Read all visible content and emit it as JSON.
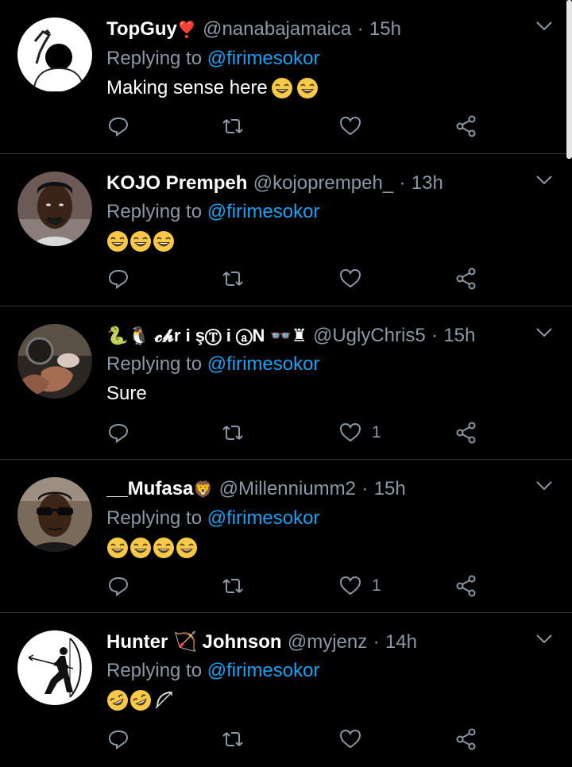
{
  "colors": {
    "background": "#000000",
    "name": "#ffffff",
    "secondary": "#8b98a5",
    "link": "#1da1f2",
    "divider": "#2f3336",
    "heart_icon": "#e0245e"
  },
  "reply_prefix": "Replying to",
  "tweets": [
    {
      "name": "TopGuy",
      "name_emoji": "❣️",
      "handle": "@nanabajamaica",
      "dot": "·",
      "time": "15h",
      "reply_to": "@firimesokor",
      "text": "Making sense here",
      "emojis": [
        "laughing-emoji",
        "laughing-emoji"
      ],
      "likes": "",
      "icons": [
        "reply-icon",
        "retweet-icon",
        "like-icon",
        "share-icon"
      ]
    },
    {
      "name": "KOJO Prempeh",
      "handle": "@kojoprempeh_",
      "dot": "·",
      "time": "13h",
      "reply_to": "@firimesokor",
      "text": "",
      "emojis": [
        "laughing-emoji",
        "laughing-emoji",
        "laughing-emoji"
      ],
      "likes": "",
      "icons": [
        "reply-icon",
        "retweet-icon",
        "like-icon",
        "share-icon"
      ]
    },
    {
      "name": "🐍🐧 𝓬𝓱r i şⓉ i ⓐN 👓♜",
      "handle": "@UglyChris5",
      "dot": "·",
      "time": "15h",
      "reply_to": "@firimesokor",
      "text": "Sure",
      "emojis": [],
      "likes": "1",
      "icons": [
        "reply-icon",
        "retweet-icon",
        "like-icon",
        "share-icon"
      ]
    },
    {
      "name": "__Mufasa",
      "name_emoji": "🦁",
      "handle": "@Millenniumm2",
      "dot": "·",
      "time": "15h",
      "reply_to": "@firimesokor",
      "text": "",
      "emojis": [
        "laughing-emoji",
        "laughing-emoji",
        "laughing-emoji",
        "laughing-emoji"
      ],
      "likes": "1",
      "icons": [
        "reply-icon",
        "retweet-icon",
        "like-icon",
        "share-icon"
      ]
    },
    {
      "name": "Hunter 🏹 Johnson",
      "handle": "@myjenz",
      "dot": "·",
      "time": "14h",
      "reply_to": "@firimesokor",
      "text": "",
      "emojis": [
        "rofl-emoji",
        "rofl-emoji",
        "bow-arrow-emoji"
      ],
      "likes": "",
      "icons": [
        "reply-icon",
        "retweet-icon",
        "like-icon",
        "share-icon"
      ]
    }
  ]
}
